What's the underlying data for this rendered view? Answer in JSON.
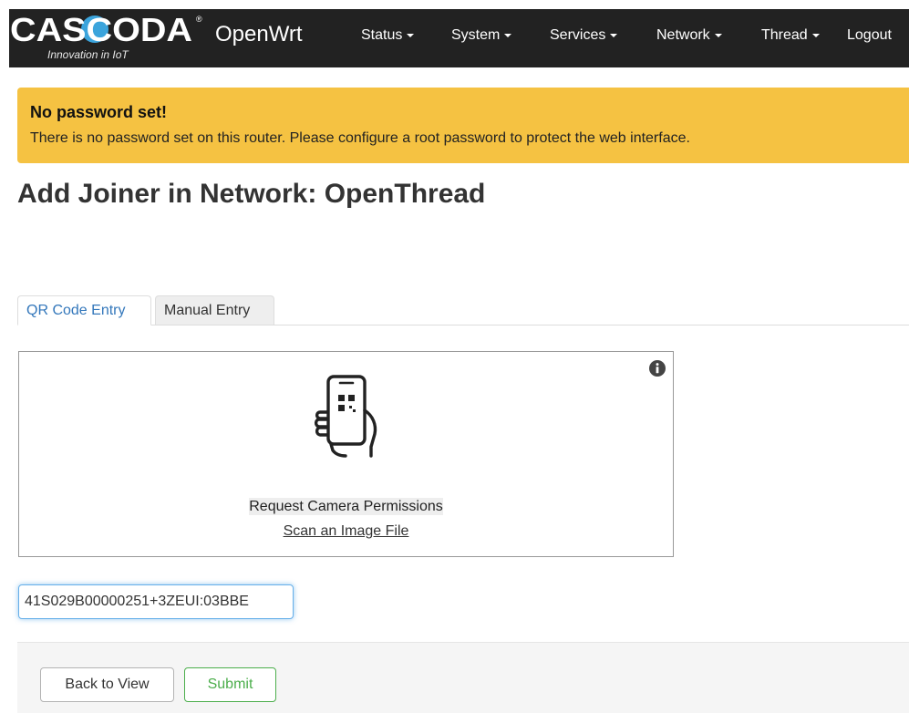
{
  "navbar": {
    "logo_text": "CASCODA",
    "tagline": "Innovation in IoT",
    "brand": "OpenWrt",
    "menus": [
      "Status",
      "System",
      "Services",
      "Network",
      "Thread",
      "Logout"
    ]
  },
  "alert": {
    "title": "No password set!",
    "message": "There is no password set on this router. Please configure a root password to protect the web interface."
  },
  "page": {
    "title": "Add Joiner in Network: OpenThread"
  },
  "tabs": [
    {
      "label": "QR Code Entry",
      "active": true
    },
    {
      "label": "Manual Entry",
      "active": false
    }
  ],
  "scanner": {
    "request_camera": "Request Camera Permissions",
    "scan_file": "Scan an Image File",
    "info_icon": "info-circle-icon",
    "phone_icon": "phone-qr-scan-icon"
  },
  "joiner_code": {
    "value": "41S029B00000251+3ZEUI:03BBE"
  },
  "actions": {
    "back_label": "Back to View",
    "submit_label": "Submit"
  },
  "colors": {
    "navbar_bg": "#222222",
    "alert_bg": "#f5c242",
    "tab_active": "#3377bb",
    "submit": "#4cae4c",
    "logo_accent": "#3ba4dc"
  }
}
